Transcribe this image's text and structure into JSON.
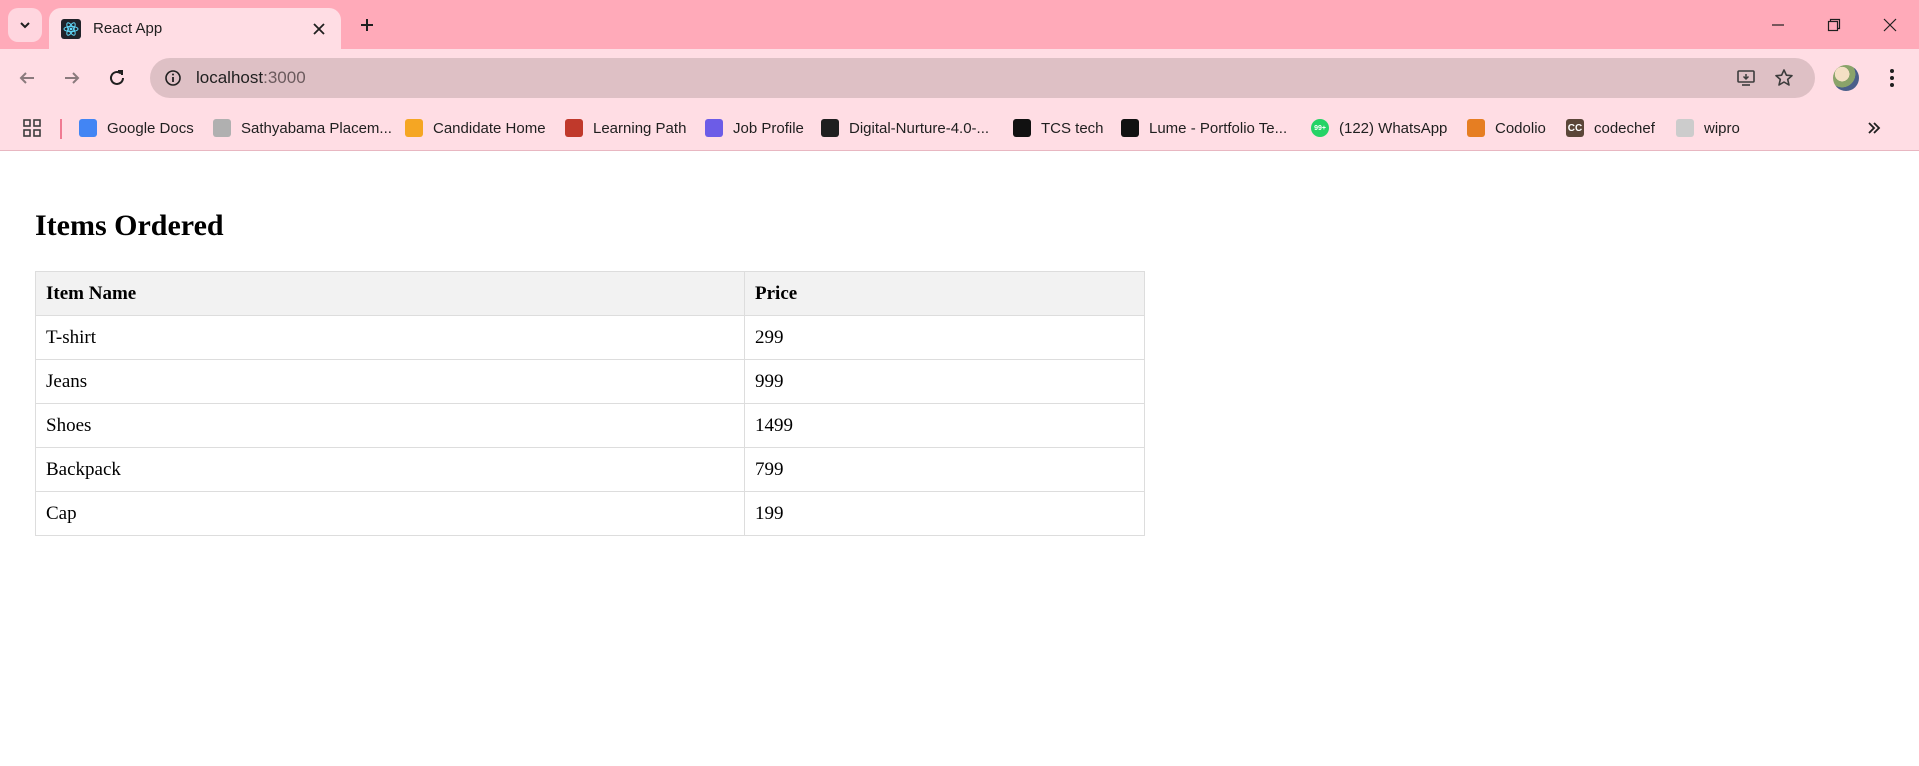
{
  "browser": {
    "tab": {
      "title": "React App",
      "icon": "react-icon"
    },
    "address": {
      "host": "localhost",
      "port": ":3000"
    },
    "bookmarks": [
      {
        "label": "Google Docs",
        "icon": "google-docs-icon",
        "color": "#4285f4"
      },
      {
        "label": "Sathyabama Placem...",
        "icon": "sathyabama-icon",
        "color": "#b0b0b0"
      },
      {
        "label": "Candidate Home",
        "icon": "workday-icon",
        "color": "#f5a623"
      },
      {
        "label": "Learning Path",
        "icon": "learning-path-icon",
        "color": "#c0392b"
      },
      {
        "label": "Job Profile",
        "icon": "job-profile-icon",
        "color": "#6c5ce7"
      },
      {
        "label": "Digital-Nurture-4.0-...",
        "icon": "github-icon",
        "color": "#1f1f1f"
      },
      {
        "label": "TCS tech",
        "icon": "tcs-icon",
        "color": "#111111"
      },
      {
        "label": "Lume - Portfolio Te...",
        "icon": "framer-icon",
        "color": "#111111"
      },
      {
        "label": "(122) WhatsApp",
        "icon": "whatsapp-icon",
        "color": "#25d366",
        "badge": "99+"
      },
      {
        "label": "Codolio",
        "icon": "codolio-icon",
        "color": "#e67e22"
      },
      {
        "label": "codechef",
        "icon": "codechef-icon",
        "color": "#5b4638",
        "mark": "CC"
      },
      {
        "label": "wipro",
        "icon": "wipro-icon",
        "color": "#cccccc"
      }
    ]
  },
  "page": {
    "heading": "Items Ordered",
    "table": {
      "headers": [
        "Item Name",
        "Price"
      ],
      "rows": [
        [
          "T-shirt",
          "299"
        ],
        [
          "Jeans",
          "999"
        ],
        [
          "Shoes",
          "1499"
        ],
        [
          "Backpack",
          "799"
        ],
        [
          "Cap",
          "199"
        ]
      ]
    }
  }
}
